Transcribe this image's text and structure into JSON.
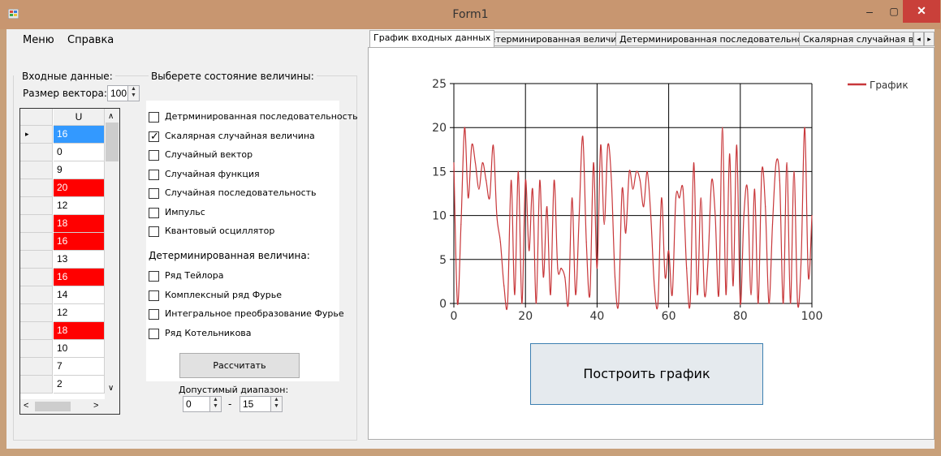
{
  "window": {
    "title": "Form1",
    "minimize": "–",
    "maximize": "▢",
    "close": "✕"
  },
  "menu": {
    "items": [
      "Меню",
      "Справка"
    ]
  },
  "left": {
    "input_group": "Входные данные:",
    "vector_size_label": "Размер вектора:",
    "vector_size_value": "100",
    "grid_header": "U",
    "grid_values": [
      "16",
      "0",
      "9",
      "20",
      "12",
      "18",
      "16",
      "13",
      "16",
      "14",
      "12",
      "18",
      "10",
      "7",
      "2"
    ],
    "highlight_color": "#ff0000",
    "selected_color": "#3399ff"
  },
  "state": {
    "group_title": "Выберете состояние величины:",
    "options": [
      {
        "label": "Детрминированная последовательность",
        "checked": false
      },
      {
        "label": "Скалярная случайная величина",
        "checked": true
      },
      {
        "label": "Случайный вектор",
        "checked": false
      },
      {
        "label": "Случайная функция",
        "checked": false
      },
      {
        "label": "Случайная последовательность",
        "checked": false
      },
      {
        "label": "Импульс",
        "checked": false
      },
      {
        "label": "Квантовый осциллятор",
        "checked": false
      }
    ],
    "det_title": "Детерминированная величина:",
    "det_options": [
      {
        "label": "Ряд Тейлора",
        "checked": false
      },
      {
        "label": "Комплексный ряд Фурье",
        "checked": false
      },
      {
        "label": "Интегральное преобразование Фурье",
        "checked": false
      },
      {
        "label": "Ряд Котельникова",
        "checked": false
      }
    ],
    "calc_button": "Рассчитать",
    "range_label": "Допустимый диапазон:",
    "range_from": "0",
    "range_dash": "-",
    "range_to": "15"
  },
  "tabs": {
    "items": [
      "График входных данных",
      "Детерминированная величина",
      "Детерминированная последовательность",
      "Скалярная случайная вели"
    ],
    "active": 0,
    "scroll_left": "◂",
    "scroll_right": "▸"
  },
  "plot": {
    "build_button": "Построить график"
  },
  "chart_data": {
    "type": "line",
    "series": [
      {
        "name": "График",
        "color": "#c8373a",
        "x": [
          0,
          1,
          2,
          3,
          4,
          5,
          6,
          7,
          8,
          9,
          10,
          11,
          12,
          13,
          14,
          15,
          16,
          17,
          18,
          19,
          20,
          21,
          22,
          23,
          24,
          25,
          26,
          27,
          28,
          29,
          30,
          31,
          32,
          33,
          34,
          35,
          36,
          37,
          38,
          39,
          40,
          41,
          42,
          43,
          44,
          45,
          46,
          47,
          48,
          49,
          50,
          51,
          52,
          53,
          54,
          55,
          56,
          57,
          58,
          59,
          60,
          61,
          62,
          63,
          64,
          65,
          66,
          67,
          68,
          69,
          70,
          71,
          72,
          73,
          74,
          75,
          76,
          77,
          78,
          79,
          80,
          81,
          82,
          83,
          84,
          85,
          86,
          87,
          88,
          89,
          90,
          91,
          92,
          93,
          94,
          95,
          96,
          97,
          98,
          99,
          100
        ],
        "values": [
          16,
          0,
          9,
          20,
          12,
          18,
          16,
          13,
          16,
          14,
          12,
          18,
          10,
          7,
          2,
          0,
          14,
          1,
          15,
          0,
          14,
          6,
          13,
          0,
          14,
          3,
          11,
          1,
          14,
          4,
          4,
          3,
          0,
          12,
          1,
          10,
          19,
          7,
          1,
          16,
          4,
          18,
          9,
          18,
          14,
          3,
          0,
          13,
          8,
          15,
          13,
          15,
          14,
          11,
          15,
          10,
          2,
          0,
          12,
          3,
          6,
          1,
          12,
          12,
          13,
          4,
          0,
          16,
          1,
          12,
          1,
          5,
          14,
          10,
          1,
          20,
          1,
          17,
          2,
          18,
          0,
          10,
          13,
          1,
          13,
          0,
          15,
          11,
          0,
          9,
          16,
          14,
          0,
          16,
          0,
          15,
          0,
          5,
          20,
          3,
          10
        ]
      }
    ],
    "xlim": [
      0,
      100
    ],
    "ylim": [
      0,
      25
    ],
    "xticks": [
      0,
      20,
      40,
      60,
      80,
      100
    ],
    "yticks": [
      0,
      5,
      10,
      15,
      20,
      25
    ],
    "grid": true,
    "legend": "top-right"
  }
}
